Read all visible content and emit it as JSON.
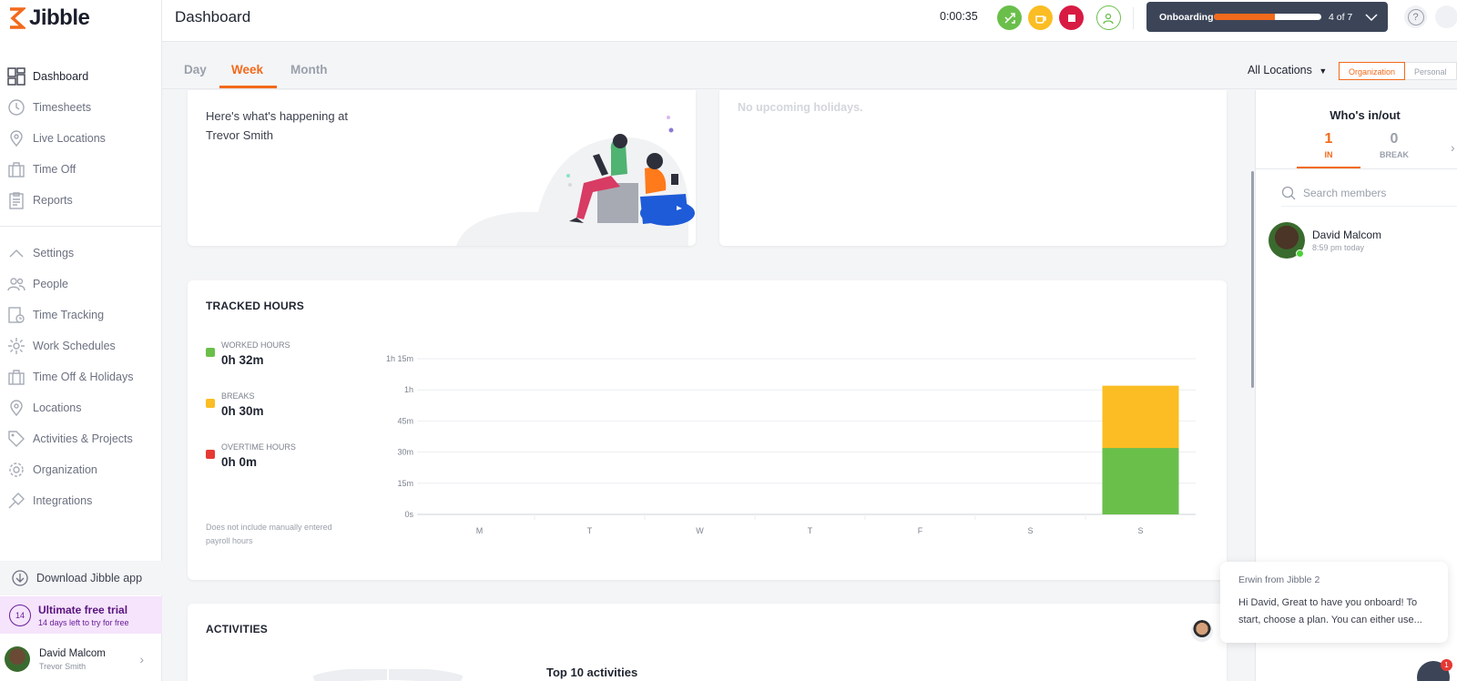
{
  "app": {
    "name": "Jibble"
  },
  "sidebar": {
    "main_items": [
      {
        "label": "Dashboard",
        "icon": "dashboard-icon"
      },
      {
        "label": "Timesheets",
        "icon": "clock-icon"
      },
      {
        "label": "Live Locations",
        "icon": "location-pin-icon"
      },
      {
        "label": "Time Off",
        "icon": "suitcase-icon"
      },
      {
        "label": "Reports",
        "icon": "clipboard-icon"
      }
    ],
    "settings_items": [
      {
        "label": "Settings",
        "icon": "chevron-up-icon"
      },
      {
        "label": "People",
        "icon": "people-icon"
      },
      {
        "label": "Time Tracking",
        "icon": "time-tracking-icon"
      },
      {
        "label": "Work Schedules",
        "icon": "schedule-icon"
      },
      {
        "label": "Time Off & Holidays",
        "icon": "suitcase-icon"
      },
      {
        "label": "Locations",
        "icon": "location-pin-icon"
      },
      {
        "label": "Activities & Projects",
        "icon": "tag-icon"
      },
      {
        "label": "Organization",
        "icon": "gear-icon"
      },
      {
        "label": "Integrations",
        "icon": "plug-icon"
      }
    ],
    "download_label": "Download Jibble app",
    "trial": {
      "days": "14",
      "title": "Ultimate free trial",
      "subtitle": "14 days left to try for free"
    },
    "user": {
      "name": "David Malcom",
      "org": "Trevor Smith"
    }
  },
  "header": {
    "title": "Dashboard",
    "timer": "0:00:35",
    "onboarding": {
      "label": "Onboarding",
      "progress": 0.57,
      "count": "4 of 7"
    }
  },
  "tabs": {
    "items": [
      "Day",
      "Week",
      "Month"
    ],
    "active": "Week"
  },
  "filters": {
    "locations": "All Locations",
    "segments": [
      "Organization",
      "Personal"
    ],
    "active_segment": "Organization"
  },
  "welcome": {
    "text": "Here's what's happening at Trevor Smith"
  },
  "holidays": {
    "text": "No upcoming holidays."
  },
  "tracked": {
    "title": "TRACKED HOURS",
    "legend": [
      {
        "label": "WORKED HOURS",
        "value": "0h 32m",
        "color": "#6abf4b"
      },
      {
        "label": "BREAKS",
        "value": "0h 30m",
        "color": "#fbbd23"
      },
      {
        "label": "OVERTIME HOURS",
        "value": "0h 0m",
        "color": "#e53935"
      }
    ],
    "note": "Does not include manually entered payroll hours"
  },
  "chart_data": {
    "type": "bar",
    "stacked": true,
    "categories": [
      "M",
      "T",
      "W",
      "T",
      "F",
      "S",
      "S"
    ],
    "y_ticks": [
      "0s",
      "15m",
      "30m",
      "45m",
      "1h",
      "1h 15m"
    ],
    "ylim": [
      0,
      75
    ],
    "series": [
      {
        "name": "WORKED HOURS",
        "values": [
          0,
          0,
          0,
          0,
          0,
          0,
          32
        ],
        "color": "#6abf4b"
      },
      {
        "name": "BREAKS",
        "values": [
          0,
          0,
          0,
          0,
          0,
          0,
          30
        ],
        "color": "#fbbd23"
      }
    ],
    "grid": true
  },
  "activities": {
    "title": "ACTIVITIES",
    "subtitle": "Top 10 activities"
  },
  "who": {
    "title": "Who's in/out",
    "stats": [
      {
        "num": "1",
        "label": "IN",
        "color": "#f26a1b"
      },
      {
        "num": "0",
        "label": "BREAK",
        "color": "#9aa0ab"
      }
    ],
    "search_placeholder": "Search members",
    "members": [
      {
        "name": "David Malcom",
        "time": "8:59 pm today"
      }
    ]
  },
  "chat": {
    "from": "Erwin from Jibble 2",
    "message": "Hi David, Great to have you onboard! To start, choose a plan. You can either use...",
    "badge": "1"
  },
  "colors": {
    "accent": "#f26a1b",
    "navy": "#3c4558"
  }
}
